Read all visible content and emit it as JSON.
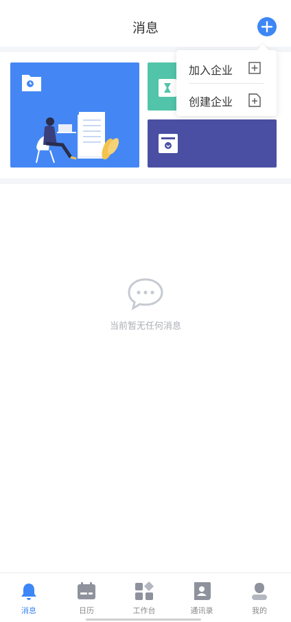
{
  "header": {
    "title": "消息",
    "add_icon": "plus-circle-icon",
    "accent": "#3d86f5"
  },
  "cards": [
    {
      "name": "main-card",
      "color": "#4487f4",
      "icon": "folder-clock-icon"
    },
    {
      "name": "teal-card",
      "color": "#52c4a9",
      "icon": "hourglass-icon"
    },
    {
      "name": "indigo-card",
      "color": "#4a4fa4",
      "icon": "archive-box-icon"
    }
  ],
  "dropdown": {
    "items": [
      {
        "label": "加入企业",
        "icon": "plus-square-icon"
      },
      {
        "label": "创建企业",
        "icon": "file-plus-icon"
      }
    ]
  },
  "empty": {
    "icon": "chat-bubble-icon",
    "text": "当前暂无任何消息"
  },
  "tabbar": {
    "items": [
      {
        "label": "消息",
        "icon": "bell-icon",
        "active": true
      },
      {
        "label": "日历",
        "icon": "calendar-icon",
        "active": false
      },
      {
        "label": "工作台",
        "icon": "grid-icon",
        "active": false
      },
      {
        "label": "通讯录",
        "icon": "contacts-icon",
        "active": false
      },
      {
        "label": "我的",
        "icon": "user-icon",
        "active": false
      }
    ]
  }
}
